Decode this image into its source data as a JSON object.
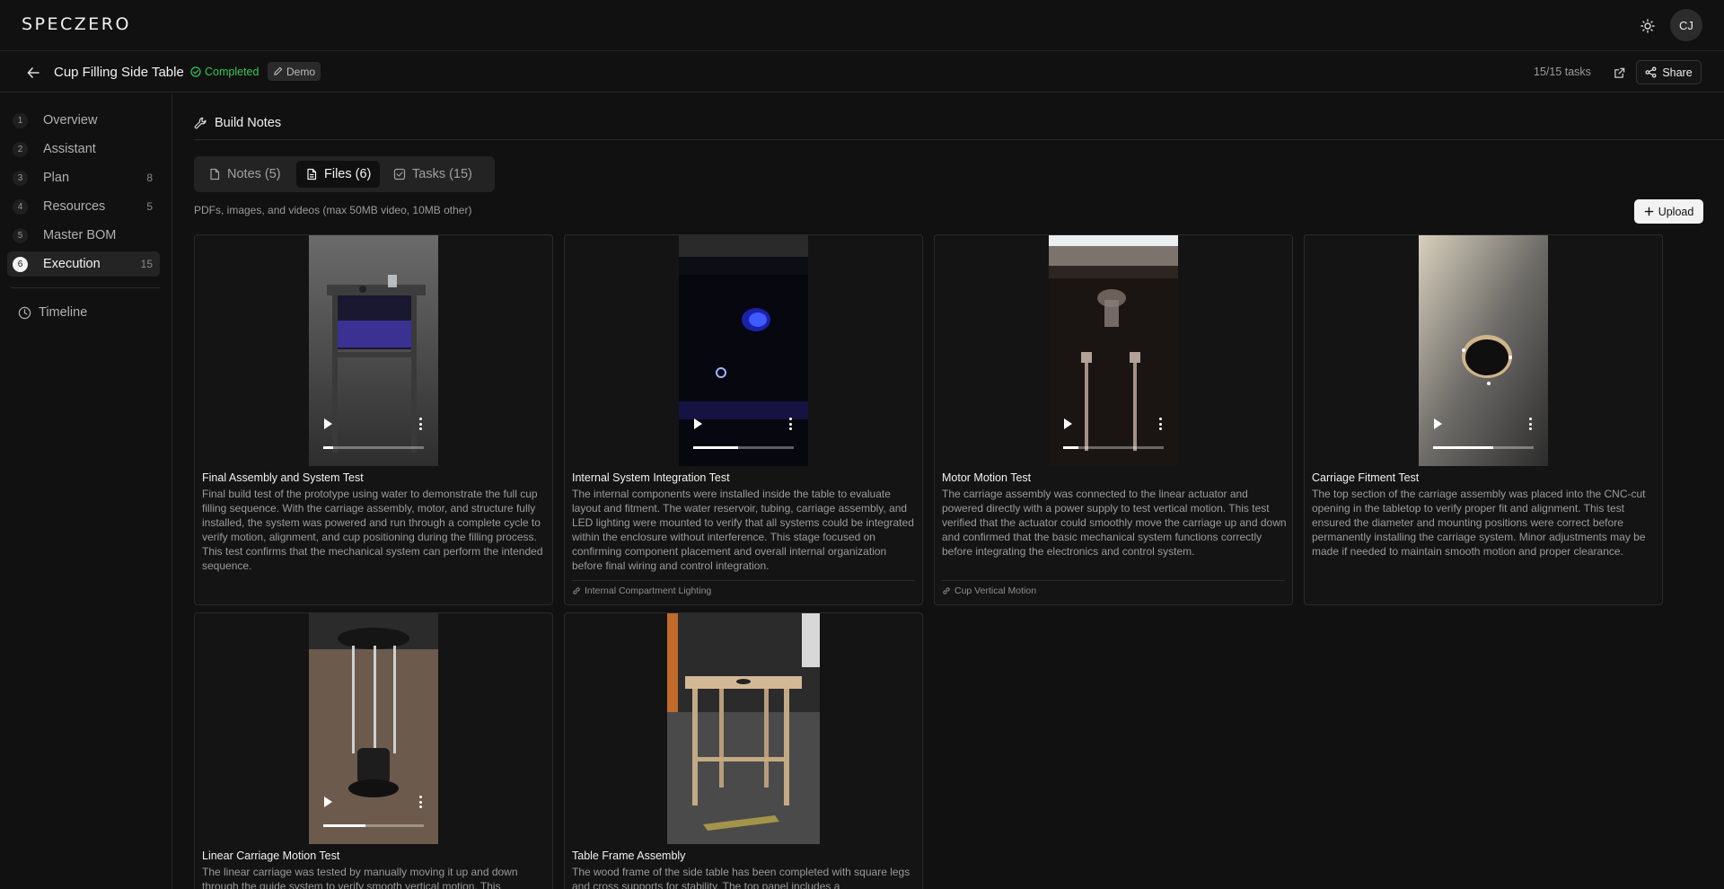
{
  "app": {
    "logo": "SPECZERO",
    "avatar_initials": "CJ"
  },
  "project": {
    "title": "Cup Filling Side Table",
    "status": "Completed",
    "badge": "Demo",
    "task_count": "15/15 tasks",
    "share_label": "Share"
  },
  "sidebar": {
    "items": [
      {
        "num": "1",
        "label": "Overview",
        "count": ""
      },
      {
        "num": "2",
        "label": "Assistant",
        "count": ""
      },
      {
        "num": "3",
        "label": "Plan",
        "count": "8"
      },
      {
        "num": "4",
        "label": "Resources",
        "count": "5"
      },
      {
        "num": "5",
        "label": "Master BOM",
        "count": ""
      },
      {
        "num": "6",
        "label": "Execution",
        "count": "15"
      }
    ],
    "timeline_label": "Timeline"
  },
  "main": {
    "section_title": "Build Notes",
    "tabs": [
      {
        "label": "Notes (5)"
      },
      {
        "label": "Files (6)"
      },
      {
        "label": "Tasks (15)"
      }
    ],
    "hint": "PDFs, images, and videos (max 50MB video, 10MB other)",
    "upload_label": "Upload",
    "files": [
      {
        "title": "Final Assembly and System Test",
        "desc": "Final build test of the prototype using water to demonstrate the full cup filling sequence. With the carriage assembly, motor, and structure fully installed, the system was powered and run through a complete cycle to verify motion, alignment, and cup positioning during the filling process. This test confirms that the mechanical system can perform the intended sequence.",
        "link": "",
        "progress": 0.1
      },
      {
        "title": "Internal System Integration Test",
        "desc": "The internal components were installed inside the table to evaluate layout and fitment. The water reservoir, tubing, carriage assembly, and LED lighting were mounted to verify that all systems could be integrated within the enclosure without interference. This stage focused on confirming component placement and overall internal organization before final wiring and control integration.",
        "link": "Internal Compartment Lighting",
        "progress": 0.45
      },
      {
        "title": "Motor Motion Test",
        "desc": "The carriage assembly was connected to the linear actuator and powered directly with a power supply to test vertical motion. This test verified that the actuator could smoothly move the carriage up and down and confirmed that the basic mechanical system functions correctly before integrating the electronics and control system.",
        "link": "Cup Vertical Motion",
        "progress": 0.15
      },
      {
        "title": "Carriage Fitment Test",
        "desc": "The top section of the carriage assembly was placed into the CNC-cut opening in the tabletop to verify proper fit and alignment. This test ensured the diameter and mounting positions were correct before permanently installing the carriage system. Minor adjustments may be made if needed to maintain smooth motion and proper clearance.",
        "link": "",
        "progress": 0.6
      },
      {
        "title": "Linear Carriage Motion Test",
        "desc": "The linear carriage was tested by manually moving it up and down through the guide system to verify smooth vertical motion. This",
        "link": "",
        "progress": 0.42
      },
      {
        "title": "Table Frame Assembly",
        "desc": "The wood frame of the side table has been completed with square legs and cross supports for stability. The top panel includes a",
        "link": "",
        "progress": null
      }
    ]
  }
}
